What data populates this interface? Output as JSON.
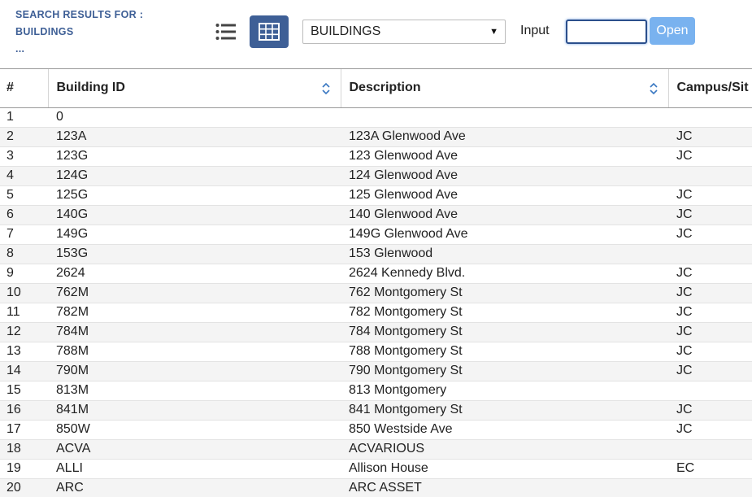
{
  "header": {
    "title_line1": "SEARCH RESULTS FOR :",
    "title_line2": "BUILDINGS",
    "title_line3": "..."
  },
  "toolbar": {
    "list_view_icon": "list-icon",
    "grid_view_icon": "grid-icon",
    "select_value": "BUILDINGS",
    "input_label": "Input",
    "input_value": "",
    "open_label": "Open",
    "accent_color": "#3e5f96",
    "open_color": "#79b2ef"
  },
  "table": {
    "columns": [
      {
        "label": "#",
        "sortable": false
      },
      {
        "label": "Building ID",
        "sortable": true
      },
      {
        "label": "Description",
        "sortable": true
      },
      {
        "label": "Campus/Sit",
        "sortable": false
      }
    ],
    "rows": [
      [
        "1",
        "0",
        "",
        ""
      ],
      [
        "2",
        "123A",
        "123A Glenwood Ave",
        "JC"
      ],
      [
        "3",
        "123G",
        "123 Glenwood Ave",
        "JC"
      ],
      [
        "4",
        "124G",
        "124 Glenwood Ave",
        ""
      ],
      [
        "5",
        "125G",
        "125 Glenwood Ave",
        "JC"
      ],
      [
        "6",
        "140G",
        "140 Glenwood Ave",
        "JC"
      ],
      [
        "7",
        "149G",
        "149G Glenwood Ave",
        "JC"
      ],
      [
        "8",
        "153G",
        "153 Glenwood",
        ""
      ],
      [
        "9",
        "2624",
        "2624 Kennedy Blvd.",
        "JC"
      ],
      [
        "10",
        "762M",
        "762 Montgomery St",
        "JC"
      ],
      [
        "11",
        "782M",
        "782 Montgomery St",
        "JC"
      ],
      [
        "12",
        "784M",
        "784 Montgomery St",
        "JC"
      ],
      [
        "13",
        "788M",
        "788 Montgomery St",
        "JC"
      ],
      [
        "14",
        "790M",
        "790 Montgomery St",
        "JC"
      ],
      [
        "15",
        "813M",
        "813 Montgomery",
        ""
      ],
      [
        "16",
        "841M",
        "841 Montgomery St",
        "JC"
      ],
      [
        "17",
        "850W",
        "850 Westside Ave",
        "JC"
      ],
      [
        "18",
        "ACVA",
        "ACVARIOUS",
        ""
      ],
      [
        "19",
        "ALLI",
        "Allison House",
        "EC"
      ],
      [
        "20",
        "ARC",
        "ARC ASSET",
        ""
      ]
    ]
  }
}
